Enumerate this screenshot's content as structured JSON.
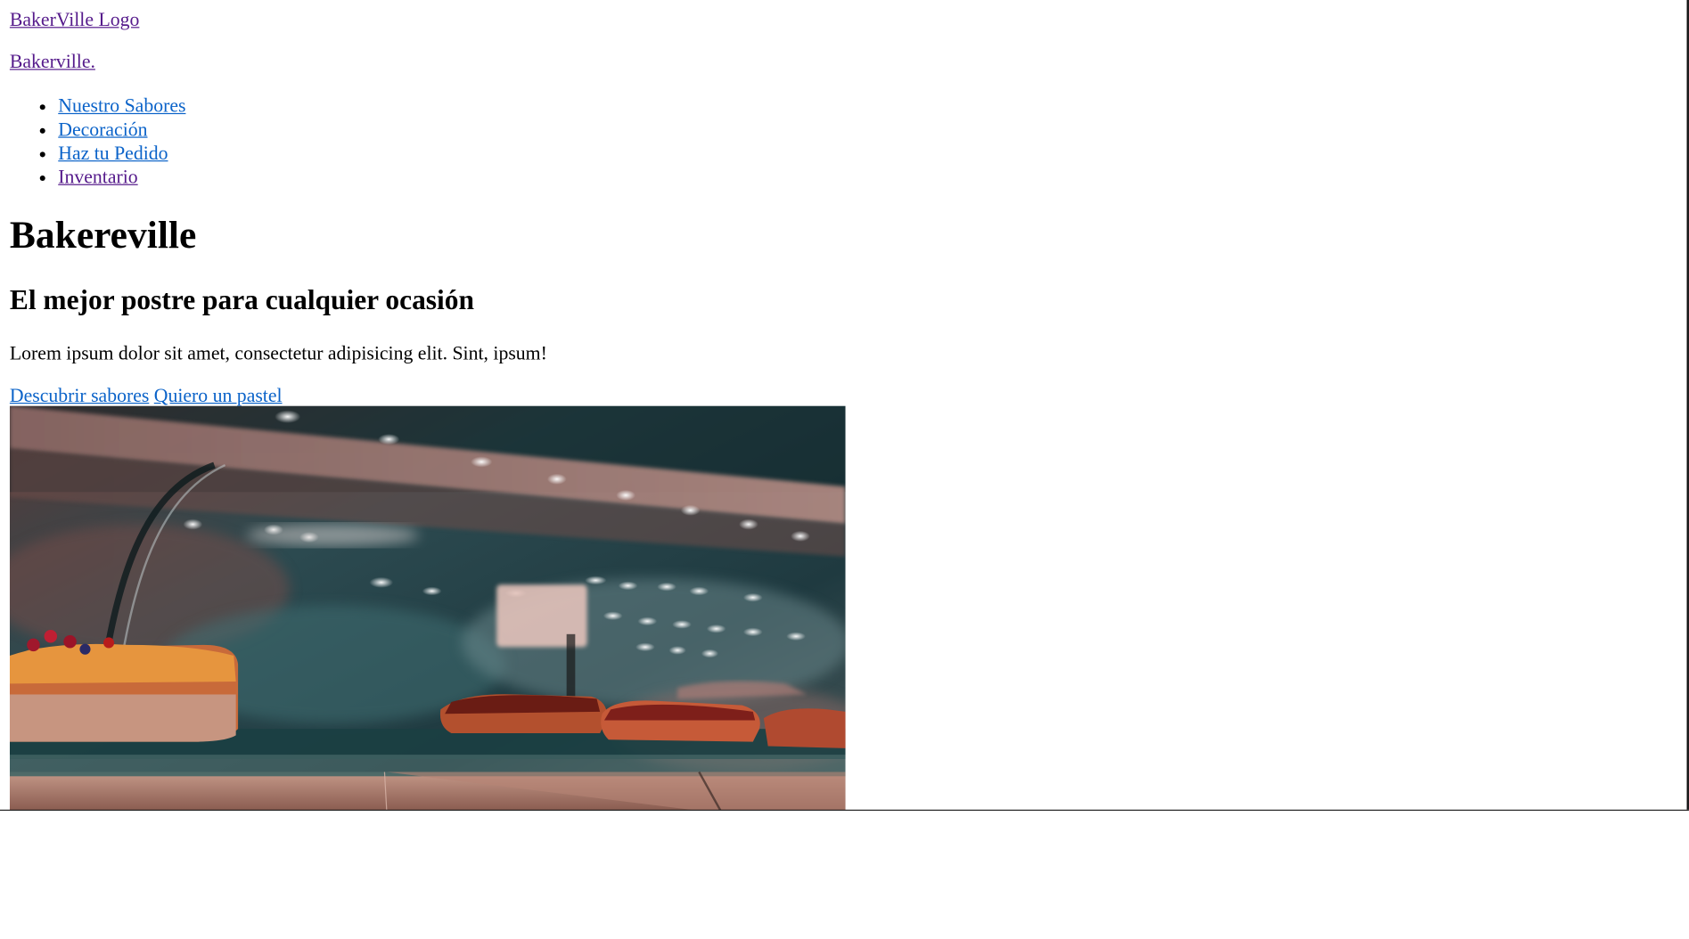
{
  "header": {
    "logo_text": "BakerVille Logo",
    "brand_text": "Bakerville."
  },
  "nav": {
    "items": [
      {
        "label": "Nuestro Sabores"
      },
      {
        "label": "Decoración"
      },
      {
        "label": "Haz tu Pedido"
      },
      {
        "label": "Inventario"
      }
    ]
  },
  "hero": {
    "title": "Bakereville",
    "subtitle": "El mejor postre para cualquier ocasión",
    "text": "Lorem ipsum dolor sit amet, consectetur adipisicing elit. Sint, ipsum!",
    "cta_primary": "Descubrir sabores",
    "cta_secondary": "Quiero un pastel"
  },
  "colors": {
    "visited_link": "#551a8b",
    "link": "#0b63c9"
  }
}
